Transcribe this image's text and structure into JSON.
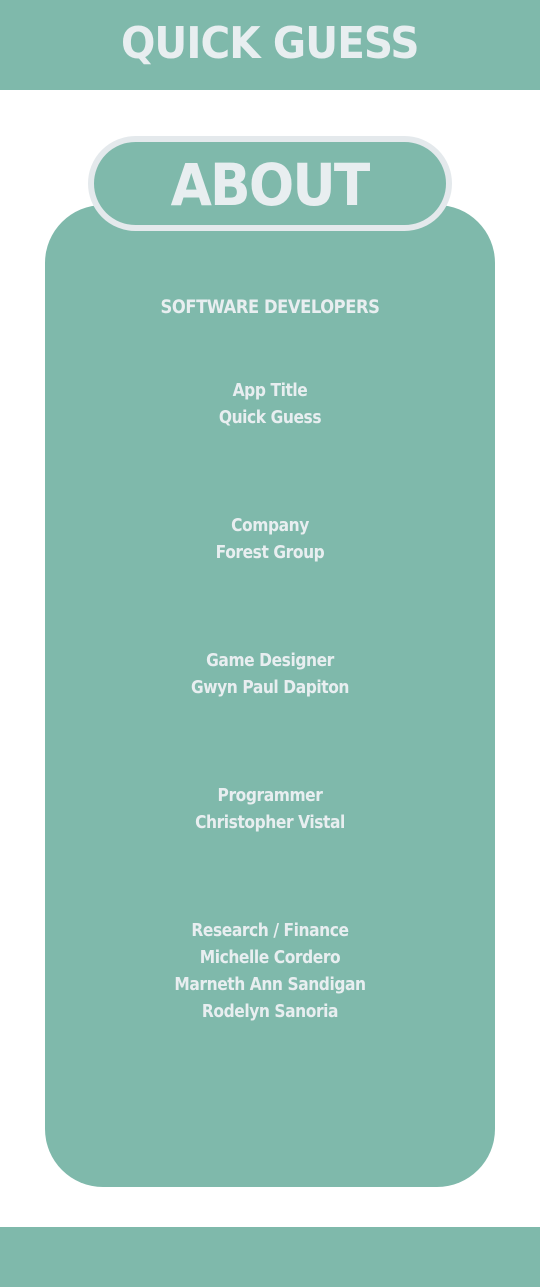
{
  "header": {
    "title": "QUICK GUESS"
  },
  "about": {
    "title": "ABOUT",
    "section_heading": "SOFTWARE DEVELOPERS",
    "credits": [
      {
        "role": "App Title",
        "names": [
          "Quick Guess"
        ]
      },
      {
        "role": "Company",
        "names": [
          "Forest Group"
        ]
      },
      {
        "role": "Game Designer",
        "names": [
          "Gwyn Paul Dapiton"
        ]
      },
      {
        "role": "Programmer",
        "names": [
          "Christopher Vistal"
        ]
      },
      {
        "role": "Research / Finance",
        "names": [
          "Michelle Cordero",
          "Marneth Ann Sandigan",
          "Rodelyn Sanoria"
        ]
      }
    ]
  },
  "colors": {
    "primary": "#7fb9ab",
    "text": "#e8eef0",
    "pill_border": "#e4e9ec",
    "background": "#ffffff"
  }
}
